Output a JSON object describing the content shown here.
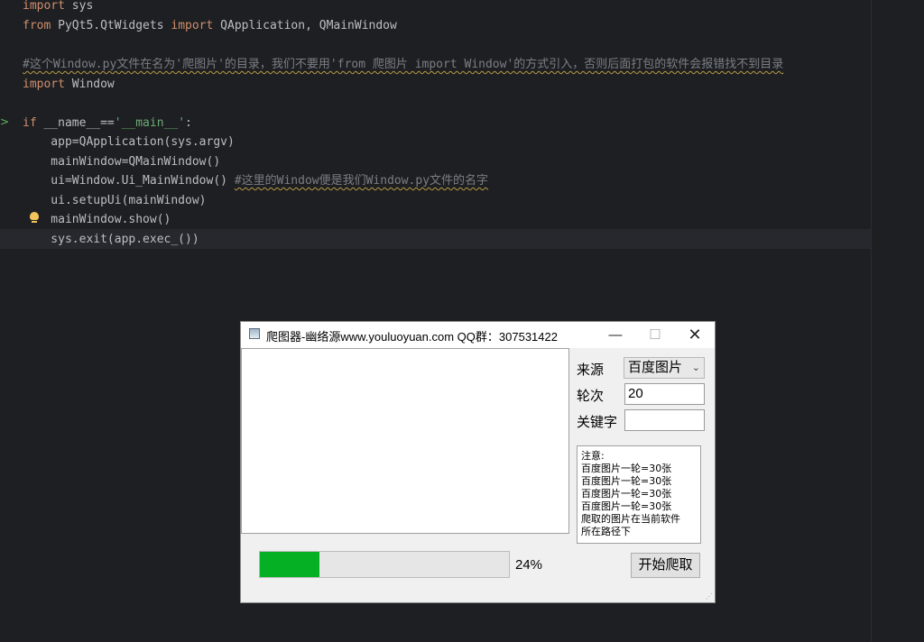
{
  "editor": {
    "lines": [
      [
        "import",
        " sys"
      ],
      [
        "from",
        " PyQt5.QtWidgets ",
        "import",
        " QApplication, QMainWindow"
      ],
      [
        ""
      ],
      [
        "#这个Window.py文件在名为'爬图片'的目录，我们不要用'from 爬图片 import Window'的方式引入，否则后面打包的软件会报错找不到目录"
      ],
      [
        "import",
        " Window"
      ],
      [
        ""
      ],
      [
        "if",
        " __name__==",
        "'__main__'",
        ":"
      ],
      [
        "    app=QApplication(sys.argv)"
      ],
      [
        "    mainWindow=QMainWindow()"
      ],
      [
        "    ui=Window.Ui_MainWindow() ",
        "#这里的Window便是我们Window.py文件的名字"
      ],
      [
        "    ui.setupUi(mainWindow)"
      ],
      [
        "    mainWindow.show()"
      ],
      [
        "    sys.exit(app.exec_())"
      ]
    ],
    "run_arrow": ">",
    "colors": {
      "background": "#1e1f22",
      "keyword": "#cf8e6d",
      "string": "#6aab73",
      "comment": "#7a7e85",
      "text": "#bcbec4"
    }
  },
  "window": {
    "title": "爬图器-幽络源www.youluoyuan.com QQ群：307531422",
    "minimize": "—",
    "maximize": "☐",
    "close": "✕",
    "source_label": "来源",
    "source_value": "百度图片",
    "rounds_label": "轮次",
    "rounds_value": "20",
    "keyword_label": "关键字",
    "keyword_value": "",
    "notes": [
      "注意:",
      "百度图片一轮=30张",
      "百度图片一轮=30张",
      "百度图片一轮=30张",
      "百度图片一轮=30张",
      "爬取的图片在当前软件",
      "所在路径下"
    ],
    "progress_percent": 24,
    "progress_text": "24%",
    "start_button": "开始爬取",
    "progress_color": "#06b025"
  }
}
